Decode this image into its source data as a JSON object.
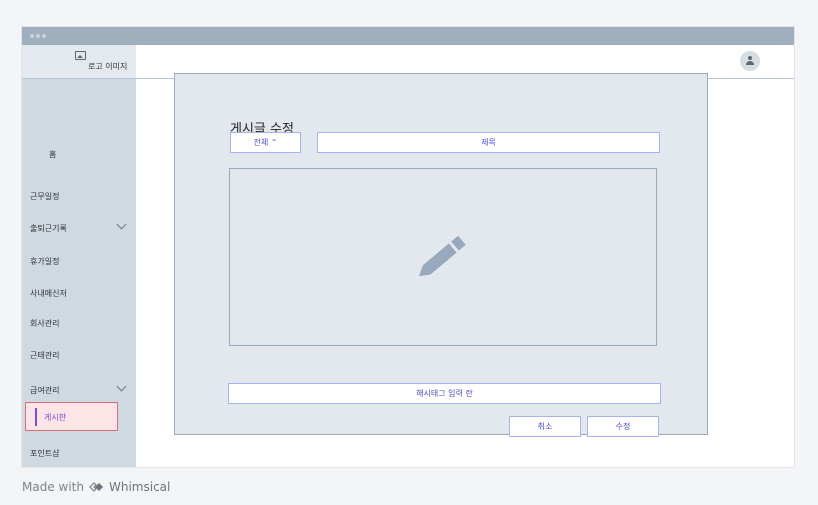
{
  "logo": {
    "icon": "image-icon",
    "label": "로고 이미지"
  },
  "topbar": {
    "avatar_icon": "user-icon"
  },
  "sidebar": {
    "items": [
      {
        "label": "홈"
      },
      {
        "label": "근무일정"
      },
      {
        "label": "출퇴근기록",
        "icon": "chevron-down-icon"
      },
      {
        "label": "휴가일정"
      },
      {
        "label": "사내메신저"
      },
      {
        "label": "회사관리"
      },
      {
        "label": "근태관리"
      },
      {
        "label": "급여관리",
        "icon": "chevron-down-icon"
      },
      {
        "label": "게시판",
        "active": true
      },
      {
        "label": "포인트샵"
      }
    ]
  },
  "editor": {
    "heading": "게시글 수정",
    "category_value": "전체 ⌃",
    "title_placeholder": "제목",
    "content_icon": "pencil-icon",
    "hashtag_placeholder": "해시태그 입력 란",
    "cancel_label": "취소",
    "submit_label": "수정"
  },
  "footer": {
    "made_with": "Made with",
    "brand": "Whimsical"
  },
  "colors": {
    "sidebar_bg": "#cfd9e2",
    "titlebar_bg": "#9fafbd",
    "accent": "#4b4de0",
    "active_bg": "#fde4e6",
    "active_border": "#e26a74",
    "card_bg": "#e3e8ee"
  }
}
